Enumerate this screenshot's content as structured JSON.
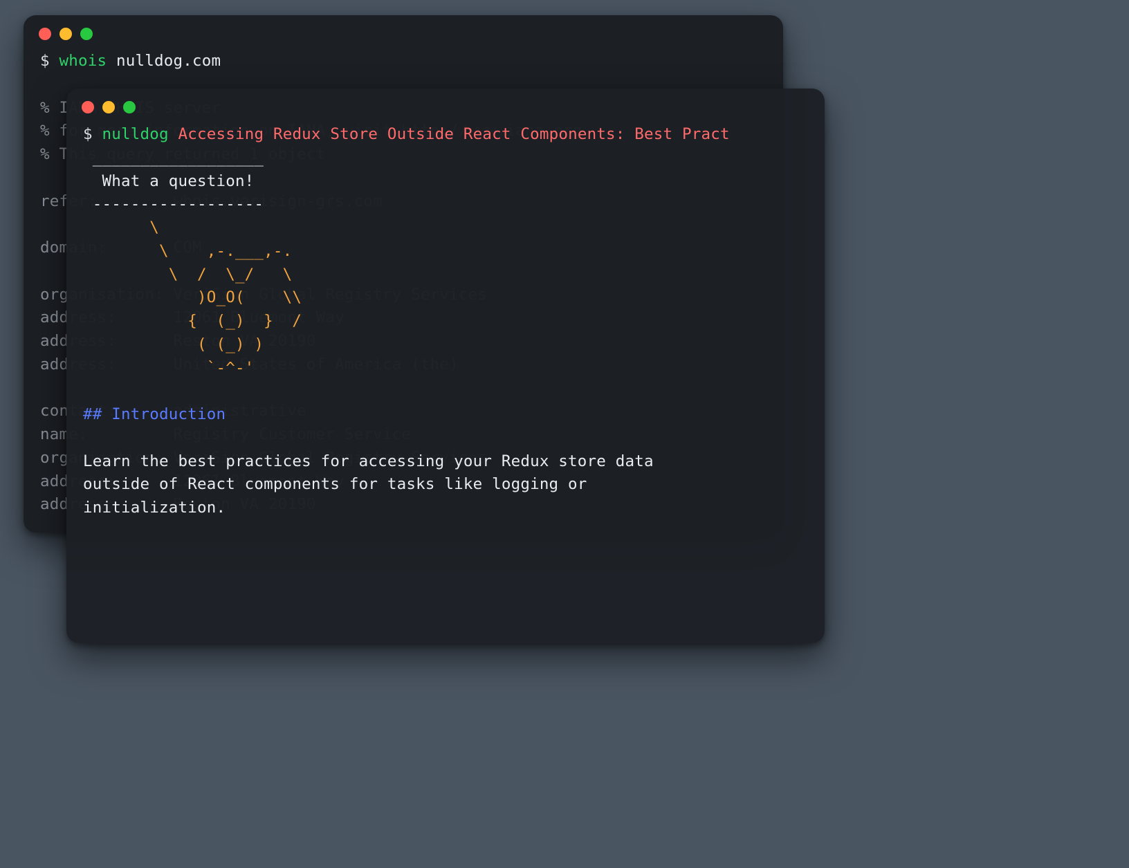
{
  "back": {
    "prompt_symbol": "$ ",
    "command": "whois ",
    "command_arg": "nulldog.com",
    "lines": [
      "% IANA WHOIS server",
      "% for more information on IANA, visit http://www.iana.org",
      "% This query returned 1 object",
      "",
      "refer:        whois.verisign-grs.com",
      "",
      "domain:       COM",
      "",
      "organisation: VeriSign Global Registry Services",
      "address:      12061 Bluemont Way",
      "address:      Reston VA 20190",
      "address:      United States of America (the)",
      "",
      "contact:      administrative",
      "name:         Registry Customer Service",
      "organisation: VeriSign Global Registry Services",
      "address:      12061 Bluemont Way",
      "address:      Reston VA 20190"
    ]
  },
  "front": {
    "prompt_symbol": "$ ",
    "command": "nulldog ",
    "title": "Accessing Redux Store Outside React Components: Best Pract",
    "bubble_top": " __________________",
    "bubble_text": "  What a question!",
    "bubble_bottom": " ------------------",
    "ascii": [
      "       \\",
      "        \\    ,-.___,-.",
      "         \\  /  \\_/   \\",
      "            )O_O(    \\\\",
      "           {  (_)  }  /",
      "            ( (_) )",
      "             `-^-'"
    ],
    "heading": "## Introduction",
    "paragraph": "Learn the best practices for accessing your Redux store data\noutside of React components for tasks like logging or\ninitialization."
  }
}
